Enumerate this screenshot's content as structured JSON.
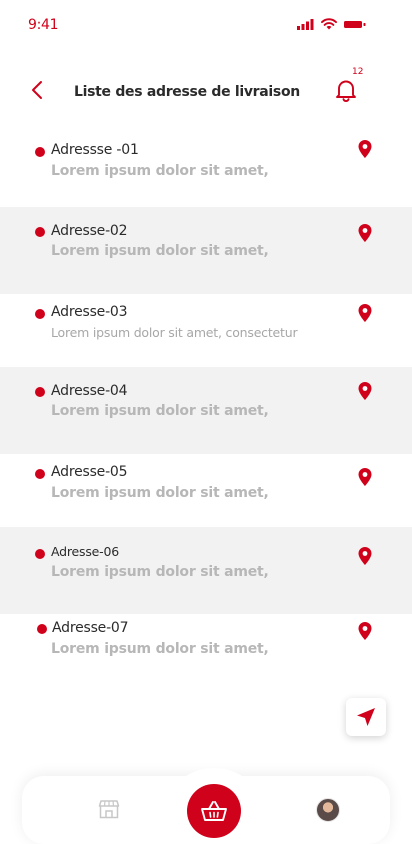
{
  "status": {
    "time": "9:41"
  },
  "header": {
    "title": "Liste des adresse de livraison",
    "notification_count": "12"
  },
  "addresses": [
    {
      "name": "Adressse -01",
      "address": "Lorem ipsum dolor sit amet,"
    },
    {
      "name": "Adresse-02",
      "address": "Lorem ipsum dolor sit amet,"
    },
    {
      "name": "Adresse-03",
      "address": "Lorem ipsum dolor sit amet, consectetur"
    },
    {
      "name": "Adresse-04",
      "address": "Lorem ipsum dolor sit amet,"
    },
    {
      "name": "Adresse-05",
      "address": "Lorem ipsum dolor sit amet,"
    },
    {
      "name": "Adresse-06",
      "address": "Lorem ipsum dolor sit amet,"
    },
    {
      "name": "Adresse-07",
      "address": "Lorem ipsum dolor sit amet,"
    }
  ],
  "icons": {
    "back": "chevron-left-icon",
    "notifications": "bell-icon",
    "location": "map-pin-icon",
    "navigate": "navigation-arrow-icon",
    "store": "store-icon",
    "basket": "basket-icon",
    "profile": "avatar"
  },
  "colors": {
    "accent": "#d0021b",
    "row_alt": "#f2f2f2",
    "muted_text": "#b7b7b7"
  }
}
